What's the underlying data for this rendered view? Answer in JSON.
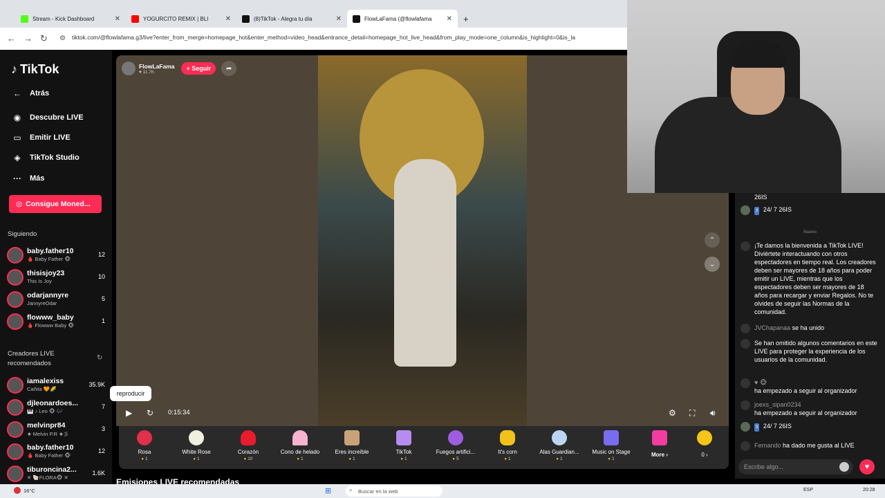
{
  "browser": {
    "tabs": [
      {
        "title": "Stream - Kick Dashboard",
        "color": "#53fc18"
      },
      {
        "title": "YOGURCITO REMIX | BLI",
        "color": "#ff0000"
      },
      {
        "title": "(8)TikTok - Alegra tu día",
        "color": "#111111"
      },
      {
        "title": "FlowLaFama (@flowlafama",
        "color": "#111111"
      }
    ],
    "new_tab": "+",
    "url": "tiktok.com/@flowlafama.g3/live?enter_from_merge=homepage_hot&enter_method=video_head&entrance_detail=homepage_hot_live_head&from_play_mode=one_column&is_highlight=0&is_la"
  },
  "sidebar": {
    "logo": "TikTok",
    "nav": [
      {
        "label": "Atrás",
        "icon": "←"
      },
      {
        "label": "Descubre LIVE",
        "icon": "◉"
      },
      {
        "label": "Emitir LIVE",
        "icon": "▭"
      },
      {
        "label": "TikTok Studio",
        "icon": "◈"
      },
      {
        "label": "Más",
        "icon": "···"
      }
    ],
    "coins_button": "Consigue Moned...",
    "following_title": "Siguiendo",
    "following": [
      {
        "name": "baby.father10",
        "sub": "🩸 Baby Father 🐵",
        "count": "12"
      },
      {
        "name": "thisisjoy23",
        "sub": "This Is Joy",
        "count": "10"
      },
      {
        "name": "odarjannyre",
        "sub": "JannyreOdar",
        "count": "5"
      },
      {
        "name": "flowww_baby",
        "sub": "🩸 Flowww Baby 🐵",
        "count": "1"
      }
    ],
    "recommended_title": "Creadores LIVE recomendados",
    "recommended": [
      {
        "name": "iamalexiss",
        "sub": "Cañita 🧡🌽",
        "count": "35.9K"
      },
      {
        "name": "djleonardoes...",
        "sub": "🎹 ♪ Leo 🐵 🎶",
        "count": "7"
      },
      {
        "name": "melvinpr84",
        "sub": "★ Melvin P.R ★彡",
        "count": "3"
      },
      {
        "name": "baby.father10",
        "sub": "🩸 Baby Father 🐵",
        "count": "12"
      },
      {
        "name": "tiburoncina2...",
        "sub": "✕ 🐚FLORA🐵 ✕",
        "count": "1.6K"
      }
    ]
  },
  "player": {
    "host_name": "FlowLaFama",
    "host_likes": "♥ 11.7K",
    "follow_label": "+ Seguir",
    "tooltip": "reproducir",
    "time": "0:15:34"
  },
  "gifts": [
    {
      "name": "Rosa",
      "price": "1",
      "color": "#e0304a"
    },
    {
      "name": "White Rose",
      "price": "1",
      "color": "#f0f0e0"
    },
    {
      "name": "Corazón",
      "price": "10",
      "color": "#e81c2c"
    },
    {
      "name": "Cono de helado",
      "price": "1",
      "color": "#f7b3cf"
    },
    {
      "name": "Eres increíble",
      "price": "1",
      "color": "#c9a27a"
    },
    {
      "name": "TikTok",
      "price": "1",
      "color": "#b58cf0"
    },
    {
      "name": "Fuegos artifici...",
      "price": "5",
      "color": "#a05ce0"
    },
    {
      "name": "It's corn",
      "price": "1",
      "color": "#f2c21b"
    },
    {
      "name": "Alas Guardian...",
      "price": "1",
      "color": "#bcd6f2"
    },
    {
      "name": "Music on Stage",
      "price": "1",
      "color": "#7a6cf0"
    },
    {
      "name": "More ›",
      "price": "",
      "color": "#f23ca0"
    }
  ],
  "coin_balance": "0 ›",
  "recommended_lives_title": "Emisiones LIVE recomendadas",
  "chat": {
    "divider": "Nuevo",
    "messages": [
      {
        "badge": "",
        "name": "",
        "text": "26IS"
      },
      {
        "badge": "3",
        "name": "",
        "text": "24/ 7 26IS"
      },
      {
        "badge": "",
        "name": "",
        "text": "¡Te damos la bienvenida a TikTok LIVE! Diviértete interactuando con otros espectadores en tiempo real. Los creadores deben ser mayores de 18 años para poder emitir un LIVE, mientras que los espectadores deben ser mayores de 18 años para recargar y enviar Regalos. No te olvides de seguir las Normas de la comunidad."
      },
      {
        "badge": "",
        "name": "JVChapanaa",
        "text": "se ha unido"
      },
      {
        "badge": "",
        "name": "",
        "text": "Se han omitido algunos comentarios en este LIVE para proteger la experiencia de los usuarios de la comunidad."
      },
      {
        "badge": "",
        "name": "♥ 🐵",
        "text": "ha empezado a seguir al organizador"
      },
      {
        "badge": "",
        "name": "joexs_sipan0234",
        "text": "ha empezado a seguir al organizador"
      },
      {
        "badge": "3",
        "name": "",
        "text": "24/ 7 26IS"
      },
      {
        "badge": "",
        "name": "Fernando",
        "text": "ha dado me gusta al LIVE"
      }
    ],
    "input_placeholder": "Escribe algo..."
  },
  "taskbar": {
    "weather": "16°C",
    "search": "Buscar en la web",
    "lang": "ESP",
    "clock": "20:28"
  }
}
